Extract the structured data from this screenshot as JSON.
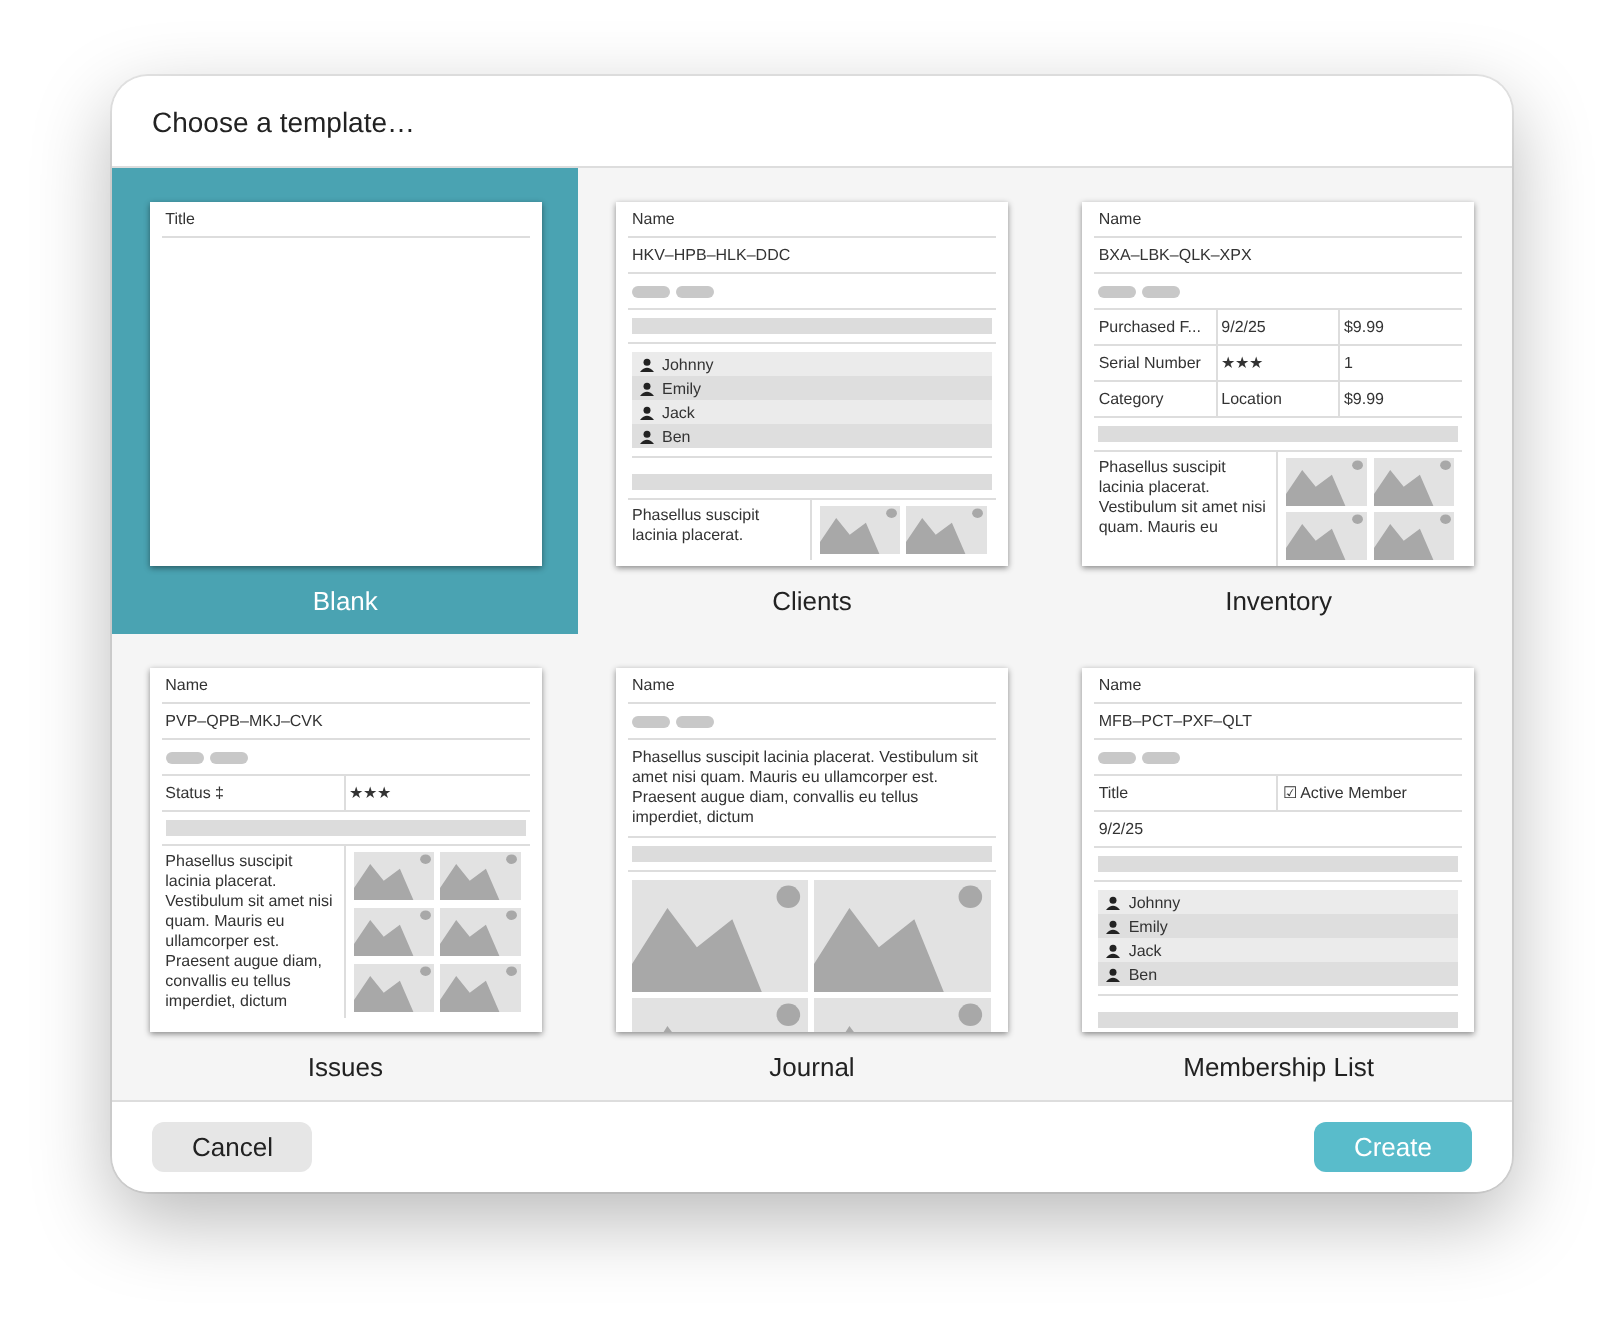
{
  "dialog": {
    "title": "Choose a template…"
  },
  "templates": [
    {
      "name": "Blank",
      "selected": true,
      "blocks": [
        {
          "kind": "label",
          "text": "Title"
        }
      ]
    },
    {
      "name": "Clients",
      "selected": false,
      "blocks": [
        {
          "kind": "label",
          "text": "Name"
        },
        {
          "kind": "label",
          "text": "HKV–HPB–HLK–DDC"
        },
        {
          "kind": "pills"
        },
        {
          "kind": "bar"
        },
        {
          "kind": "list",
          "items": [
            "Johnny",
            "Emily",
            "Jack",
            "Ben"
          ]
        },
        {
          "kind": "bar"
        },
        {
          "kind": "textpics",
          "text": "Phasellus suscipit lacinia placerat."
        }
      ]
    },
    {
      "name": "Inventory",
      "selected": false,
      "blocks": [
        {
          "kind": "label",
          "text": "Name"
        },
        {
          "kind": "label",
          "text": "BXA–LBK–QLK–XPX"
        },
        {
          "kind": "pills"
        },
        {
          "kind": "table",
          "rows": [
            [
              "Purchased F...",
              "9/2/25",
              "$9.99"
            ],
            [
              "Serial Number",
              "★★★",
              "1"
            ],
            [
              "Category",
              "Location",
              "$9.99"
            ]
          ]
        },
        {
          "kind": "bar"
        },
        {
          "kind": "textpics",
          "text": "Phasellus suscipit lacinia placerat. Vestibulum sit amet nisi quam. Mauris eu"
        }
      ]
    },
    {
      "name": "Issues",
      "selected": false,
      "blocks": [
        {
          "kind": "label",
          "text": "Name"
        },
        {
          "kind": "label",
          "text": "PVP–QPB–MKJ–CVK"
        },
        {
          "kind": "pills"
        },
        {
          "kind": "table",
          "rows": [
            [
              "Status ‡",
              "★★★"
            ]
          ]
        },
        {
          "kind": "bar"
        },
        {
          "kind": "textpics",
          "text": "Phasellus suscipit lacinia placerat. Vestibulum sit amet nisi quam. Mauris eu ullamcorper est. Praesent augue diam, convallis eu tellus imperdiet, dictum"
        }
      ]
    },
    {
      "name": "Journal",
      "selected": false,
      "blocks": [
        {
          "kind": "label",
          "text": "Name"
        },
        {
          "kind": "pills"
        },
        {
          "kind": "text",
          "text": "Phasellus suscipit lacinia placerat. Vestibulum sit amet nisi quam. Mauris eu ullamcorper est. Praesent augue diam, convallis eu tellus imperdiet, dictum"
        },
        {
          "kind": "bar"
        },
        {
          "kind": "pics"
        }
      ]
    },
    {
      "name": "Membership List",
      "selected": false,
      "blocks": [
        {
          "kind": "label",
          "text": "Name"
        },
        {
          "kind": "label",
          "text": "MFB–PCT–PXF–QLT"
        },
        {
          "kind": "pills"
        },
        {
          "kind": "table",
          "rows": [
            [
              "Title",
              "☑ Active Member"
            ]
          ]
        },
        {
          "kind": "label",
          "text": "9/2/25"
        },
        {
          "kind": "bar"
        },
        {
          "kind": "list",
          "items": [
            "Johnny",
            "Emily",
            "Jack",
            "Ben"
          ]
        },
        {
          "kind": "bar"
        }
      ]
    }
  ],
  "buttons": [
    {
      "label": "Cancel",
      "kind": "secondary"
    },
    {
      "label": "Create",
      "kind": "primary"
    }
  ]
}
